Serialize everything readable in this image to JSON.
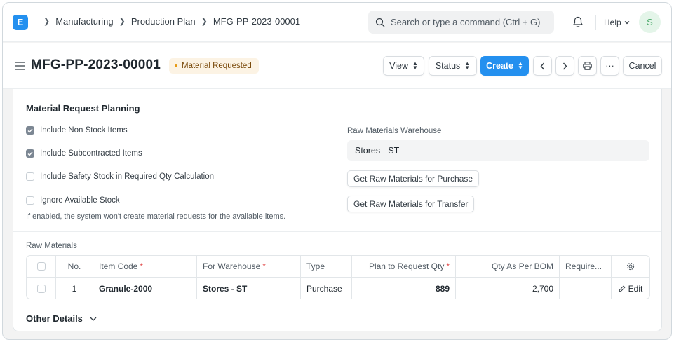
{
  "navbar": {
    "logo": "E",
    "breadcrumbs": [
      "Manufacturing",
      "Production Plan",
      "MFG-PP-2023-00001"
    ],
    "search_placeholder": "Search or type a command (Ctrl + G)",
    "help_label": "Help",
    "avatar_initial": "S"
  },
  "page": {
    "title": "MFG-PP-2023-00001",
    "status": "Material Requested",
    "buttons": {
      "view": "View",
      "status": "Status",
      "create": "Create",
      "more": "···",
      "cancel": "Cancel"
    }
  },
  "section": {
    "title": "Material Request Planning",
    "checks": [
      {
        "label": "Include Non Stock Items",
        "checked": true
      },
      {
        "label": "Include Subcontracted Items",
        "checked": true
      },
      {
        "label": "Include Safety Stock in Required Qty Calculation",
        "checked": false
      },
      {
        "label": "Ignore Available Stock",
        "checked": false
      }
    ],
    "ignore_help": "If enabled, the system won't create material requests for the available items.",
    "warehouse_label": "Raw Materials Warehouse",
    "warehouse_value": "Stores - ST",
    "get_purchase": "Get Raw Materials for Purchase",
    "get_transfer": "Get Raw Materials for Transfer"
  },
  "raw_materials": {
    "label": "Raw Materials",
    "columns": [
      "No.",
      "Item Code",
      "For Warehouse",
      "Type",
      "Plan to Request Qty",
      "Qty As Per BOM",
      "Require..."
    ],
    "rows": [
      {
        "no": "1",
        "item_code": "Granule-2000",
        "warehouse": "Stores - ST",
        "type": "Purchase",
        "plan_qty": "889",
        "bom_qty": "2,700",
        "required": "",
        "edit": "Edit"
      }
    ]
  },
  "other_details": "Other Details"
}
